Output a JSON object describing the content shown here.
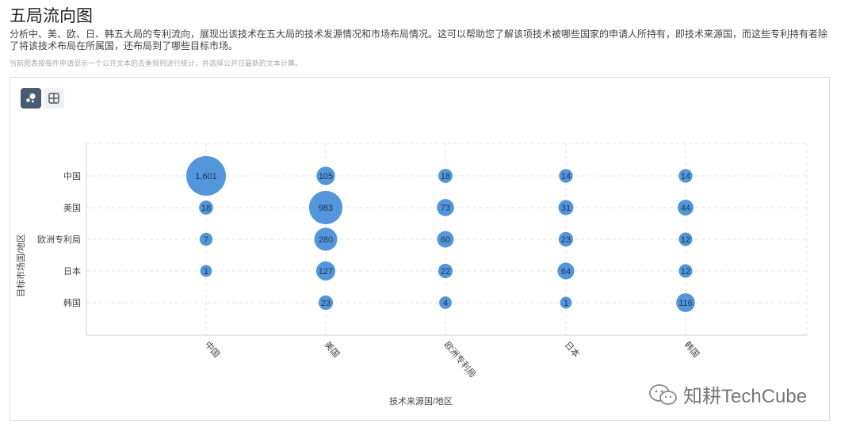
{
  "header": {
    "title": "五局流向图",
    "description": "分析中、美、欧、日、韩五大局的专利流向，展现出该技术在五大局的技术发源情况和市场布局情况。这可以帮助您了解该项技术被哪些国家的申请人所持有，即技术来源国，而这些专利持有者除了将该技术布局在所属国，还布局到了哪些目标市场。",
    "note": "当前图表按每件申请显示一个公开文本的去重规则进行统计，并选择公开日最新的文本计算。"
  },
  "toolbar": {
    "bubble_icon": "bubble-chart-icon",
    "table_icon": "table-grid-icon"
  },
  "watermark": {
    "text": "知耕TechCube",
    "icon": "wechat-icon"
  },
  "colors": {
    "bubble": "#4a90d9",
    "grid": "#e3e3e3",
    "axis": "#d0d0d0",
    "active_button": "#4a5a70"
  },
  "chart_data": {
    "type": "bubble",
    "title": "",
    "xlabel": "技术来源国/地区",
    "ylabel": "目标市场国/地区",
    "x_categories": [
      "中国",
      "美国",
      "欧洲专利局",
      "日本",
      "韩国"
    ],
    "y_categories": [
      "中国",
      "美国",
      "欧洲专利局",
      "日本",
      "韩国"
    ],
    "grid": true,
    "values": [
      [
        1601,
        105,
        18,
        14,
        14
      ],
      [
        18,
        983,
        73,
        31,
        44
      ],
      [
        7,
        280,
        60,
        23,
        12
      ],
      [
        1,
        127,
        22,
        64,
        12
      ],
      [
        null,
        23,
        4,
        1,
        116
      ]
    ],
    "value_labels": [
      [
        "1,601",
        "105",
        "18",
        "14",
        "14"
      ],
      [
        "18",
        "983",
        "73",
        "31",
        "44"
      ],
      [
        "7",
        "280",
        "60",
        "23",
        "12"
      ],
      [
        "1",
        "127",
        "22",
        "64",
        "12"
      ],
      [
        "",
        "23",
        "4",
        "1",
        "116"
      ]
    ]
  }
}
